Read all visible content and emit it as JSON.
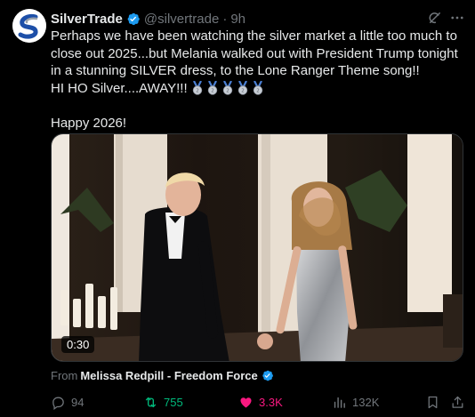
{
  "post": {
    "display_name": "SilverTrade",
    "handle": "@silvertrade",
    "separator": "·",
    "time": "9h",
    "text": "Perhaps we have been watching the silver market a little too much to close out 2025...but Melania walked out with President Trump tonight in a stunning SILVER dress, to the Lone Ranger Theme song!!\nHI HO Silver....AWAY!!! ",
    "text_tail": "\n\nHappy 2026!",
    "medal_count": 5,
    "medal_icon": "2nd-place-medal-icon"
  },
  "media": {
    "duration": "0:30"
  },
  "attribution": {
    "label": "From",
    "author": "Melissa Redpill - Freedom Force"
  },
  "actions": {
    "replies": "94",
    "reposts": "755",
    "likes": "3.3K",
    "views": "132K"
  },
  "colors": {
    "background": "#000000",
    "text": "#e7e9ea",
    "muted": "#71767b",
    "verified": "#1d9bf0",
    "repost_active": "#00ba7c",
    "like_active": "#f91880"
  }
}
